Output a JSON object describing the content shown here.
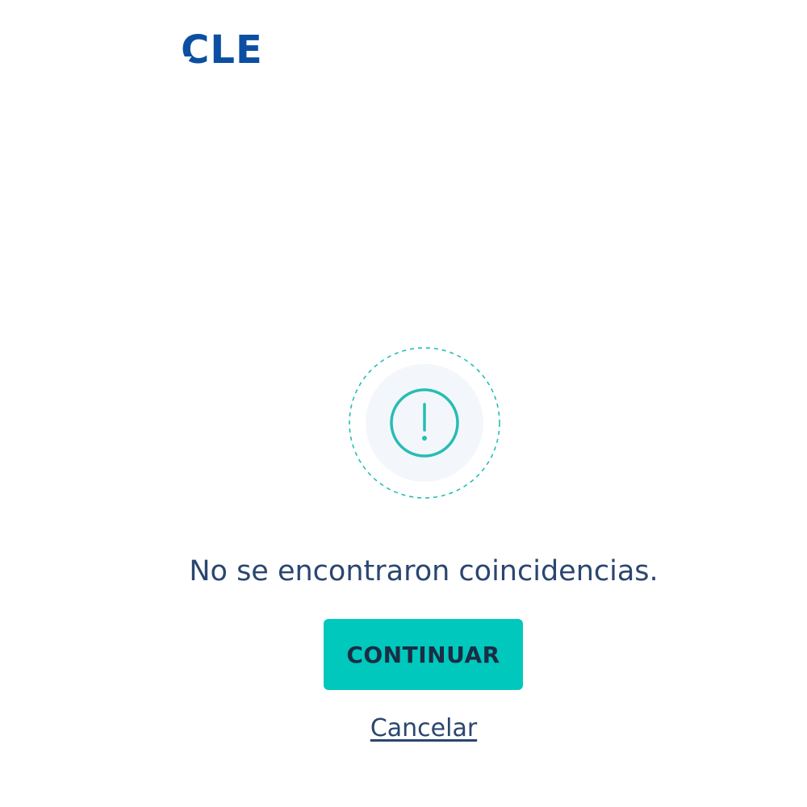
{
  "brand": {
    "logo_text": "ACLE",
    "logo_color": "#0b4fa3"
  },
  "alert": {
    "icon": "alert-circle-icon",
    "accent_color": "#26bdb4",
    "message": "No se encontraron coincidencias."
  },
  "actions": {
    "continue_label": "CONTINUAR",
    "continue_color": "#00c8bd",
    "cancel_label": "Cancelar"
  }
}
